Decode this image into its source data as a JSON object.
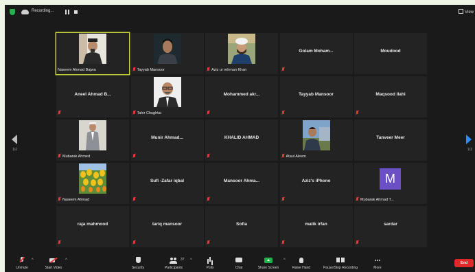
{
  "topbar": {
    "recording_label": "Recording...",
    "view_label": "View"
  },
  "pagination": {
    "left": "1/2",
    "right": "1/2"
  },
  "participants": [
    {
      "name": "Naseem Ahmad Bajwa",
      "video": true,
      "muted": false,
      "active": true,
      "photo": "man-dark-cap"
    },
    {
      "name": "Tayyab Mansoor",
      "video": true,
      "muted": true,
      "photo": "man-young-dark"
    },
    {
      "name": "Aziz ur rehman Khan",
      "video": true,
      "muted": true,
      "photo": "man-white-turban"
    },
    {
      "name": "Golam  Moham...",
      "video": false,
      "muted": true
    },
    {
      "name": "Moudood",
      "video": false,
      "muted": false
    },
    {
      "name": "Aneel Ahmad B...",
      "video": false,
      "muted": true
    },
    {
      "name": "Tahir Chughtai",
      "video": true,
      "muted": true,
      "photo": "man-glasses-suit"
    },
    {
      "name": "Mohammed  akr...",
      "video": false,
      "muted": true
    },
    {
      "name": "Tayyab Mansoor",
      "video": false,
      "muted": true
    },
    {
      "name": "Maqsood Ilahi",
      "video": false,
      "muted": true
    },
    {
      "name": "Mubarak Ahmed",
      "video": true,
      "muted": true,
      "photo": "man-standing-suit"
    },
    {
      "name": "Munir  Ahmad...",
      "video": false,
      "muted": true
    },
    {
      "name": "KHALID AHMAD",
      "video": false,
      "muted": true
    },
    {
      "name": "Ataul Aleem",
      "video": true,
      "muted": true,
      "photo": "man-landscape"
    },
    {
      "name": "Tanveer Meer",
      "video": false,
      "muted": false
    },
    {
      "name": "Naseem Ahmad",
      "video": true,
      "muted": true,
      "photo": "tulips"
    },
    {
      "name": "Sufi -Zafar iqbal",
      "video": false,
      "muted": true
    },
    {
      "name": "Mansoor  Ahma...",
      "video": false,
      "muted": true
    },
    {
      "name": "Aziz's iPhone",
      "video": false,
      "muted": true
    },
    {
      "name": "Mubarak Ahmad T...",
      "video": false,
      "muted": true,
      "avatar_letter": "M"
    },
    {
      "name": "raja mahmood",
      "video": false,
      "muted": true
    },
    {
      "name": "tariq mansoor",
      "video": false,
      "muted": true
    },
    {
      "name": "Sofia",
      "video": false,
      "muted": true
    },
    {
      "name": "malik irfan",
      "video": false,
      "muted": true
    },
    {
      "name": "sardar",
      "video": false,
      "muted": true
    }
  ],
  "toolbar": {
    "unmute": "Unmute",
    "start_video": "Start Video",
    "security": "Security",
    "participants": "Participants",
    "participants_count": "37",
    "polls": "Polls",
    "chat": "Chat",
    "share_screen": "Share Screen",
    "raise_hand": "Raise Hand",
    "pause_stop_recording": "Pause/Stop Recording",
    "more": "More",
    "end": "End"
  },
  "colors": {
    "active_speaker": "#c6d13f",
    "share_green": "#23b14d",
    "end_red": "#e02828",
    "avatar_purple": "#6b4fc4"
  }
}
